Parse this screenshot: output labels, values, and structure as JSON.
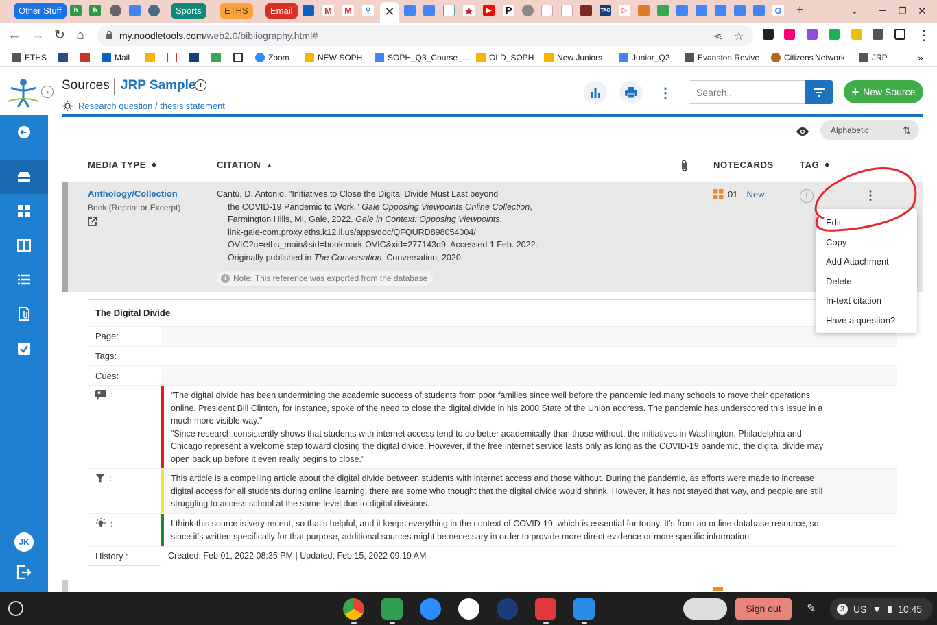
{
  "browser": {
    "tab_groups": [
      {
        "label": "Other Stuff",
        "color": "#1a73e8"
      },
      {
        "label": "Sports",
        "color": "#10897b"
      },
      {
        "label": "ETHS",
        "color": "#f8a33e"
      },
      {
        "label": "Email",
        "color": "#d93025"
      }
    ],
    "active_tab_close": "✕",
    "new_tab": "+",
    "url_host": "my.noodletools.com",
    "url_path": "/web2.0/bibliography.html#"
  },
  "bookmarks": [
    {
      "label": "ETHS",
      "icon": "folder-icon"
    },
    {
      "label": "",
      "icon": "calendar-icon"
    },
    {
      "label": "",
      "icon": "e-icon"
    },
    {
      "label": "Mail",
      "icon": "outlook-icon"
    },
    {
      "label": "",
      "icon": "classroom-icon"
    },
    {
      "label": "",
      "icon": "gmail-icon"
    },
    {
      "label": "",
      "icon": "tac-icon"
    },
    {
      "label": "",
      "icon": "drive-icon"
    },
    {
      "label": "",
      "icon": "shield-icon"
    },
    {
      "label": "Zoom",
      "icon": "zoom-icon"
    },
    {
      "label": "NEW SOPH",
      "icon": "slides-icon"
    },
    {
      "label": "SOPH_Q3_Course_...",
      "icon": "docs-icon"
    },
    {
      "label": "OLD_SOPH",
      "icon": "slides-icon"
    },
    {
      "label": "New Juniors",
      "icon": "slides-icon"
    },
    {
      "label": "Junior_Q2",
      "icon": "docs-icon"
    },
    {
      "label": "Evanston Revive",
      "icon": "folder-icon"
    },
    {
      "label": "Citizens'Network",
      "icon": "globe-icon"
    },
    {
      "label": "JRP",
      "icon": "folder-icon"
    }
  ],
  "bookmarks_more": "»",
  "header": {
    "title": "Sources",
    "project": "JRP Sample",
    "research_link": "Research question / thesis statement",
    "search_placeholder": "Search..",
    "new_source": "New Source"
  },
  "sort": {
    "selected": "Alphabetic"
  },
  "columns": {
    "media_type": "MEDIA TYPE",
    "citation": "CITATION",
    "notecards": "NOTECARDS",
    "tag": "TAG"
  },
  "source": {
    "media_type": "Anthology/Collection",
    "media_sub": "Book (Reprint or Excerpt)",
    "citation_lines": [
      {
        "parts": [
          {
            "t": "Cantù, D. Antonio. \"Initiatives to Close the Digital Divide Must Last beyond",
            "i": false
          }
        ]
      },
      {
        "parts": [
          {
            "t": "the COVID-19 Pandemic to Work.\" ",
            "i": false
          },
          {
            "t": "Gale Opposing Viewpoints Online Collection",
            "i": true
          },
          {
            "t": ",",
            "i": false
          }
        ]
      },
      {
        "parts": [
          {
            "t": "Farmington Hills, MI, Gale, 2022. ",
            "i": false
          },
          {
            "t": "Gale in Context: Opposing Viewpoints",
            "i": true
          },
          {
            "t": ",",
            "i": false
          }
        ]
      },
      {
        "parts": [
          {
            "t": "link-gale-com.proxy.eths.k12.il.us/apps/doc/QFQURD898054004/",
            "i": false
          }
        ]
      },
      {
        "parts": [
          {
            "t": "OVIC?u=eths_main&sid=bookmark-OVIC&xid=277143d9. Accessed 1 Feb. 2022.",
            "i": false
          }
        ]
      },
      {
        "parts": [
          {
            "t": "Originally published in ",
            "i": false
          },
          {
            "t": "The Conversation",
            "i": true
          },
          {
            "t": ", Conversation, 2020.",
            "i": false
          }
        ]
      }
    ],
    "note": "Note: This reference was exported from the database",
    "notecard_count": "01",
    "notecard_new": "New"
  },
  "menu": {
    "items": [
      "Edit",
      "Copy",
      "Add Attachment",
      "Delete",
      "In-text citation",
      "Have a question?"
    ],
    "annotation_color": "#e8262b"
  },
  "notecard": {
    "title": "The Digital Divide",
    "page_label": "Page:",
    "tags_label": "Tags:",
    "cues_label": "Cues:",
    "quote_label": ":",
    "paraphrase_label": ":",
    "idea_label": ":",
    "history_label": "History :",
    "quotes": [
      "\"The digital divide has been undermining the academic success of students from poor families since well before the pandemic led many schools to move their operations online. President Bill Clinton, for instance, spoke of the need to close the digital divide in his 2000 State of the Union address. The pandemic has underscored this issue in a much more visible way.\"",
      "\"Since research consistently shows that students with internet access tend to do better academically than those without, the initiatives in Washington, Philadelphia and Chicago represent a welcome step toward closing the digital divide. However, if the free internet service lasts only as long as the COVID-19 pandemic, the digital divide may open back up before it even really begins to close.\""
    ],
    "paraphrase": "This article is a compelling article about the digital divide between students with internet access and those without.  During the pandemic, as efforts were made to increase digital access for all students during online learning, there are some who thought that the digital divide would shrink. However, it has not stayed that way, and people are still struggling to access school at the same level due to digital divisions.",
    "idea": "I think this source is very recent, so that's helpful, and it keeps everything in the context of COVID-19, which is essential for today. It's from an online database resource, so since it's written specifically for that purpose, additional sources might be necessary in order to provide more direct evidence or more specific information.",
    "history": "Created: Feb 01, 2022 08:35 PM | Updated: Feb 15, 2022 09:19 AM",
    "colors": {
      "quote": "#e8171e",
      "paraphrase": "#f5e625",
      "idea": "#1e8a2e"
    }
  },
  "user_initials": "JK",
  "shelf": {
    "sign_out": "Sign out",
    "notifications": "3",
    "locale": "US",
    "time": "10:45"
  }
}
